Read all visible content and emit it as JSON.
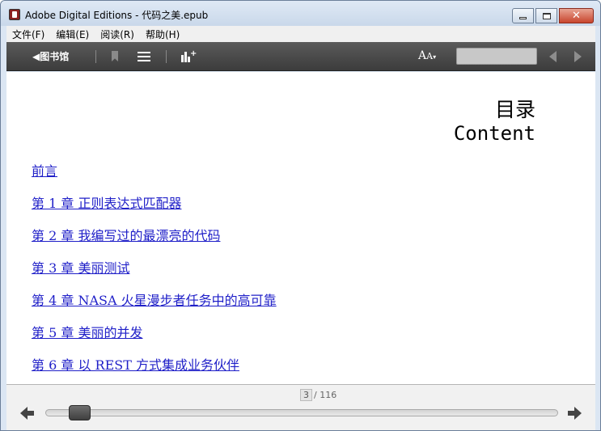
{
  "window": {
    "title": "Adobe Digital Editions - 代码之美.epub",
    "close_glyph": "✕"
  },
  "menu": [
    "文件(F)",
    "编辑(E)",
    "阅读(R)",
    "帮助(H)"
  ],
  "toolbar": {
    "library_label": "◀图书馆",
    "font_label_big": "A",
    "font_label_small": "A",
    "font_label_caret": "▾",
    "search_value": ""
  },
  "page": {
    "title": "目录",
    "subtitle": "Content",
    "toc": [
      "前言",
      "第 1 章 正则表达式匹配器",
      "第 2 章 我编写过的最漂亮的代码",
      "第 3 章 美丽测试",
      "第 4 章 NASA 火星漫步者任务中的高可靠",
      "第 5 章 美丽的并发",
      "第 6 章 以 REST 方式集成业务伙伴"
    ]
  },
  "pager": {
    "current": "3",
    "total_label": "/ 116",
    "progress_fraction": 0.03
  },
  "colors": {
    "link": "#1f1fc8",
    "toolbar_bg": "#4a4a4a"
  },
  "icons": {
    "bookmark": "bookmark-icon",
    "toc": "list-icon",
    "stats": "bar-chart-plus-icon",
    "prev_page": "chevron-left-icon",
    "next_page": "chevron-right-icon",
    "back_arrow": "arrow-left-icon",
    "forward_arrow": "arrow-right-icon"
  }
}
